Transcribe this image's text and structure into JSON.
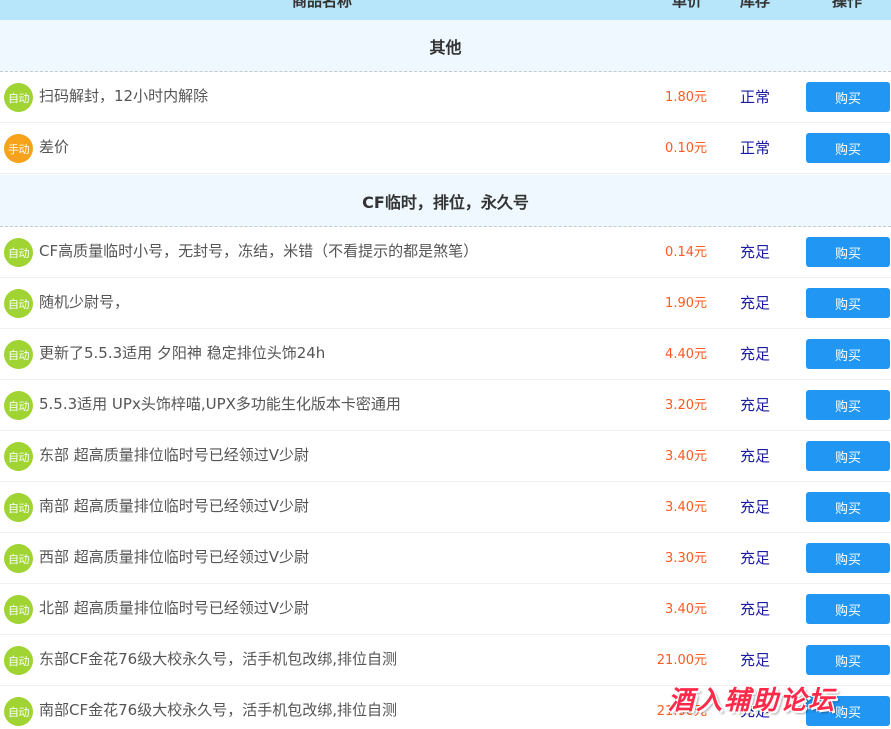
{
  "header": {
    "columns": [
      "商品名称",
      "单价",
      "库存",
      "操作"
    ]
  },
  "categories": [
    {
      "title": "其他"
    },
    {
      "title": "CF临时，排位，永久号"
    }
  ],
  "rows": [
    {
      "badge": "自动",
      "type": "auto",
      "name": "扫码解封，12小时内解除",
      "price": "1.80元",
      "status": "正常",
      "buy": "购买"
    },
    {
      "badge": "手动",
      "type": "manual",
      "name": "差价",
      "price": "0.10元",
      "status": "正常",
      "buy": "购买"
    },
    {
      "badge": "自动",
      "type": "auto",
      "name": "CF高质量临时小号，无封号，冻结，米错（不看提示的都是煞笔）",
      "price": "0.14元",
      "status": "充足",
      "buy": "购买"
    },
    {
      "badge": "自动",
      "type": "auto",
      "name": "随机少尉号，",
      "price": "1.90元",
      "status": "充足",
      "buy": "购买"
    },
    {
      "badge": "自动",
      "type": "auto",
      "name": "更新了5.5.3适用 夕阳神 稳定排位头饰24h",
      "price": "4.40元",
      "status": "充足",
      "buy": "购买"
    },
    {
      "badge": "自动",
      "type": "auto",
      "name": "5.5.3适用 UPx头饰梓喵,UPX多功能生化版本卡密通用",
      "price": "3.20元",
      "status": "充足",
      "buy": "购买"
    },
    {
      "badge": "自动",
      "type": "auto",
      "name": "东部 超高质量排位临时号已经领过V少尉",
      "price": "3.40元",
      "status": "充足",
      "buy": "购买"
    },
    {
      "badge": "自动",
      "type": "auto",
      "name": "南部 超高质量排位临时号已经领过V少尉",
      "price": "3.40元",
      "status": "充足",
      "buy": "购买"
    },
    {
      "badge": "自动",
      "type": "auto",
      "name": "西部 超高质量排位临时号已经领过V少尉",
      "price": "3.30元",
      "status": "充足",
      "buy": "购买"
    },
    {
      "badge": "自动",
      "type": "auto",
      "name": "北部 超高质量排位临时号已经领过V少尉",
      "price": "3.40元",
      "status": "充足",
      "buy": "购买"
    },
    {
      "badge": "自动",
      "type": "auto",
      "name": "东部CF金花76级大校永久号，活手机包改绑,排位自测",
      "price": "21.00元",
      "status": "充足",
      "buy": "购买"
    },
    {
      "badge": "自动",
      "type": "auto",
      "name": "南部CF金花76级大校永久号，活手机包改绑,排位自测",
      "price": "21.00元",
      "status": "充足",
      "buy": "购买"
    }
  ],
  "watermark": "酒入辅助论坛",
  "colors": {
    "header_bg": "#b7e6fb",
    "category_bg": "#eef8fe",
    "auto_badge": "#9fd433",
    "manual_badge": "#f6a31b",
    "price": "#ff5a1f",
    "status": "#1b1ba5",
    "buy_button": "#2196f3"
  }
}
